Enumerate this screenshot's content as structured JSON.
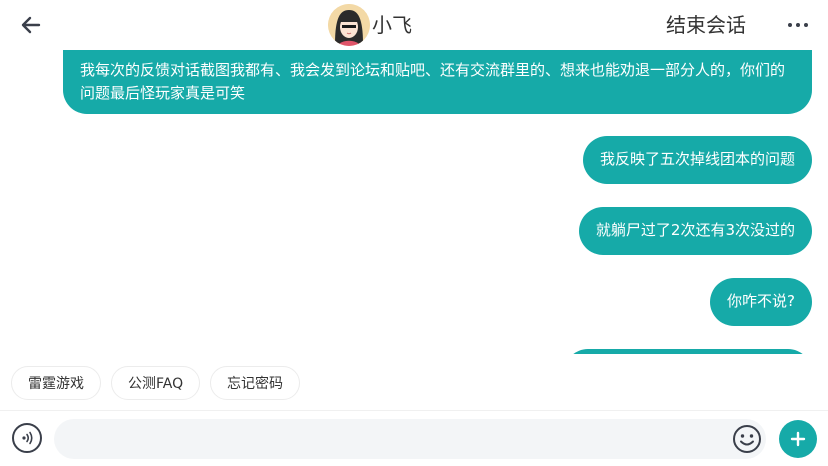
{
  "header": {
    "back_icon": "arrow-left-icon",
    "agent_name": "小飞",
    "end_session_label": "结束会话",
    "more_icon": "more-horizontal-icon"
  },
  "messages": [
    {
      "text": "我每次的反馈对话截图我都有、我会发到论坛和贴吧、还有交流群里的、想来也能劝退一部分人的，你们的问题最后怪玩家真是可笑"
    },
    {
      "text": "我反映了五次掉线团本的问题"
    },
    {
      "text": "就躺尸过了2次还有3次没过的"
    },
    {
      "text": "你咋不说?"
    },
    {
      "text": ""
    }
  ],
  "quick_replies": [
    {
      "label": "雷霆游戏"
    },
    {
      "label": "公测FAQ"
    },
    {
      "label": "忘记密码"
    }
  ],
  "input": {
    "value": "",
    "placeholder": "",
    "voice_icon": "voice-icon",
    "emoji_icon": "emoji-icon",
    "plus_icon": "plus-icon"
  },
  "colors": {
    "accent": "#16aaa8",
    "text": "#333333",
    "input_bg": "#f3f5f7"
  }
}
